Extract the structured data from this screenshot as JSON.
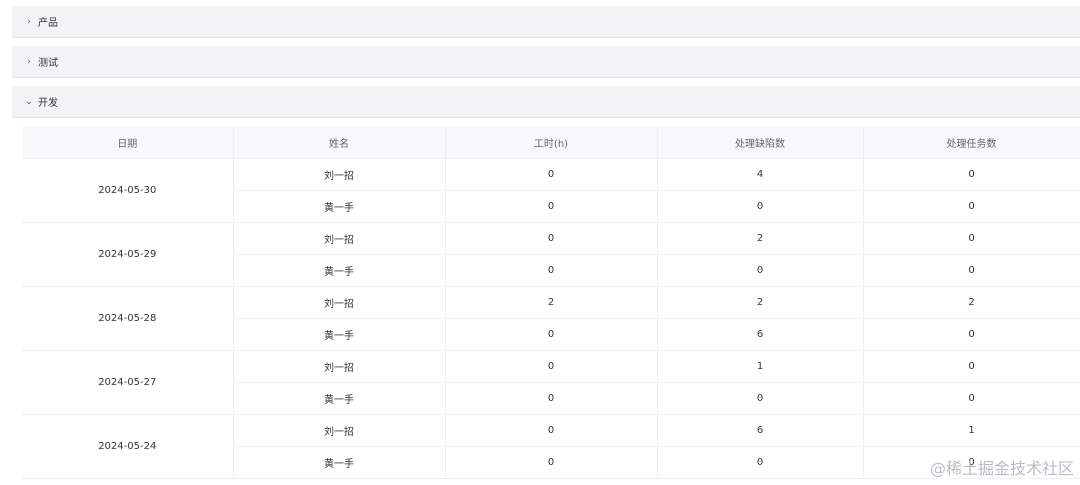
{
  "panels": [
    {
      "label": "产品",
      "chevron": "›"
    },
    {
      "label": "测试",
      "chevron": "›"
    },
    {
      "label": "开发",
      "chevron": "⌄"
    }
  ],
  "table": {
    "headers": [
      "日期",
      "姓名",
      "工时(h)",
      "处理缺陷数",
      "处理任务数"
    ],
    "groups": [
      {
        "date": "2024-05-30",
        "rows": [
          {
            "name": "刘一招",
            "hours": "0",
            "defects": "4",
            "tasks": "0"
          },
          {
            "name": "黄一手",
            "hours": "0",
            "defects": "0",
            "tasks": "0"
          }
        ]
      },
      {
        "date": "2024-05-29",
        "rows": [
          {
            "name": "刘一招",
            "hours": "0",
            "defects": "2",
            "tasks": "0"
          },
          {
            "name": "黄一手",
            "hours": "0",
            "defects": "0",
            "tasks": "0"
          }
        ]
      },
      {
        "date": "2024-05-28",
        "rows": [
          {
            "name": "刘一招",
            "hours": "2",
            "defects": "2",
            "tasks": "2"
          },
          {
            "name": "黄一手",
            "hours": "0",
            "defects": "6",
            "tasks": "0"
          }
        ]
      },
      {
        "date": "2024-05-27",
        "rows": [
          {
            "name": "刘一招",
            "hours": "0",
            "defects": "1",
            "tasks": "0"
          },
          {
            "name": "黄一手",
            "hours": "0",
            "defects": "0",
            "tasks": "0"
          }
        ]
      },
      {
        "date": "2024-05-24",
        "rows": [
          {
            "name": "刘一招",
            "hours": "0",
            "defects": "6",
            "tasks": "1"
          },
          {
            "name": "黄一手",
            "hours": "0",
            "defects": "0",
            "tasks": "0"
          }
        ]
      }
    ]
  },
  "watermark": "@稀土掘金技术社区"
}
